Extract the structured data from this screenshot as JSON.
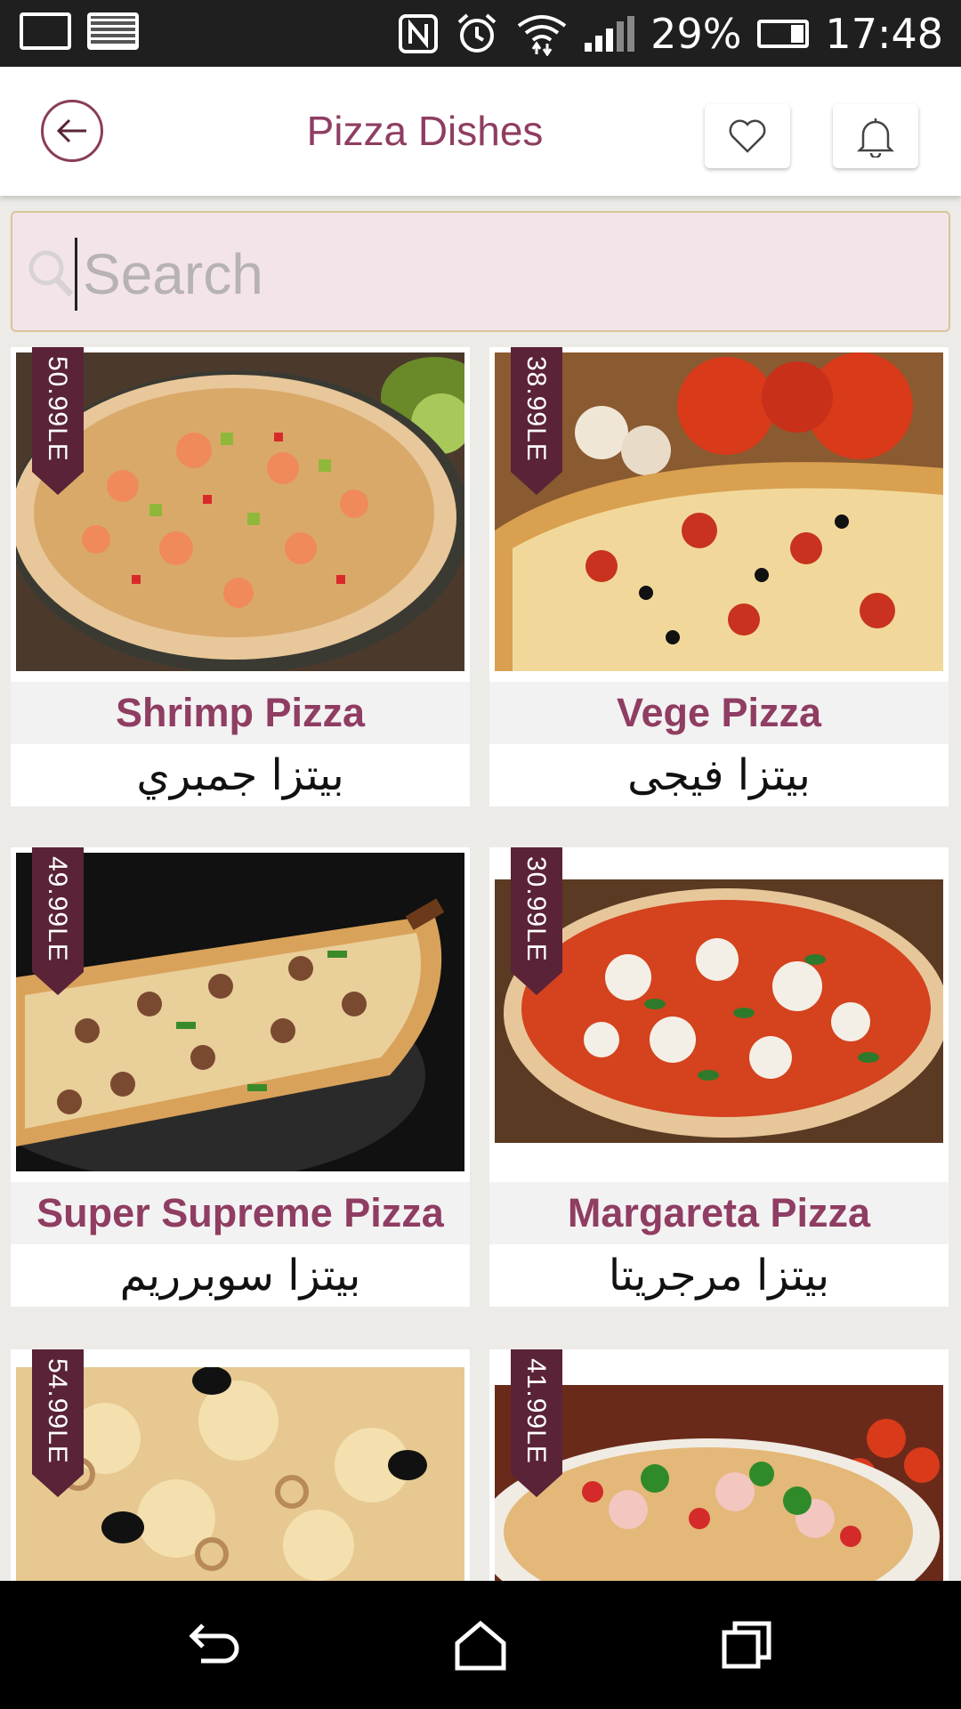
{
  "status_bar": {
    "battery_percent": "29%",
    "time": "17:48",
    "icons": [
      "battery-charging-icon",
      "image-icon",
      "nfc-icon",
      "alarm-icon",
      "wifi-icon",
      "signal-icon",
      "battery-icon"
    ]
  },
  "header": {
    "title": "Pizza Dishes",
    "back_icon": "arrow-left-icon",
    "favorite_icon": "heart-icon",
    "notification_icon": "bell-icon"
  },
  "search": {
    "placeholder": "Search",
    "value": "",
    "icon": "search-icon"
  },
  "dishes": [
    {
      "price": "50.99LE",
      "name_en": "Shrimp Pizza",
      "name_ar": "بيتزا جمبري"
    },
    {
      "price": "38.99LE",
      "name_en": "Vege Pizza",
      "name_ar": "بيتزا فيجى"
    },
    {
      "price": "49.99LE",
      "name_en": "Super Supreme Pizza",
      "name_ar": "بيتزا سوبرريم"
    },
    {
      "price": "30.99LE",
      "name_en": "Margareta Pizza",
      "name_ar": "بيتزا مرجريتا"
    },
    {
      "price": "54.99LE"
    },
    {
      "price": "41.99LE"
    }
  ],
  "colors": {
    "accent": "#8f3d62",
    "price_tag": "#5a2338",
    "search_bg": "#f3e4ea"
  },
  "nav_bar": {
    "icons": [
      "back-icon",
      "home-icon",
      "recent-apps-icon"
    ]
  }
}
